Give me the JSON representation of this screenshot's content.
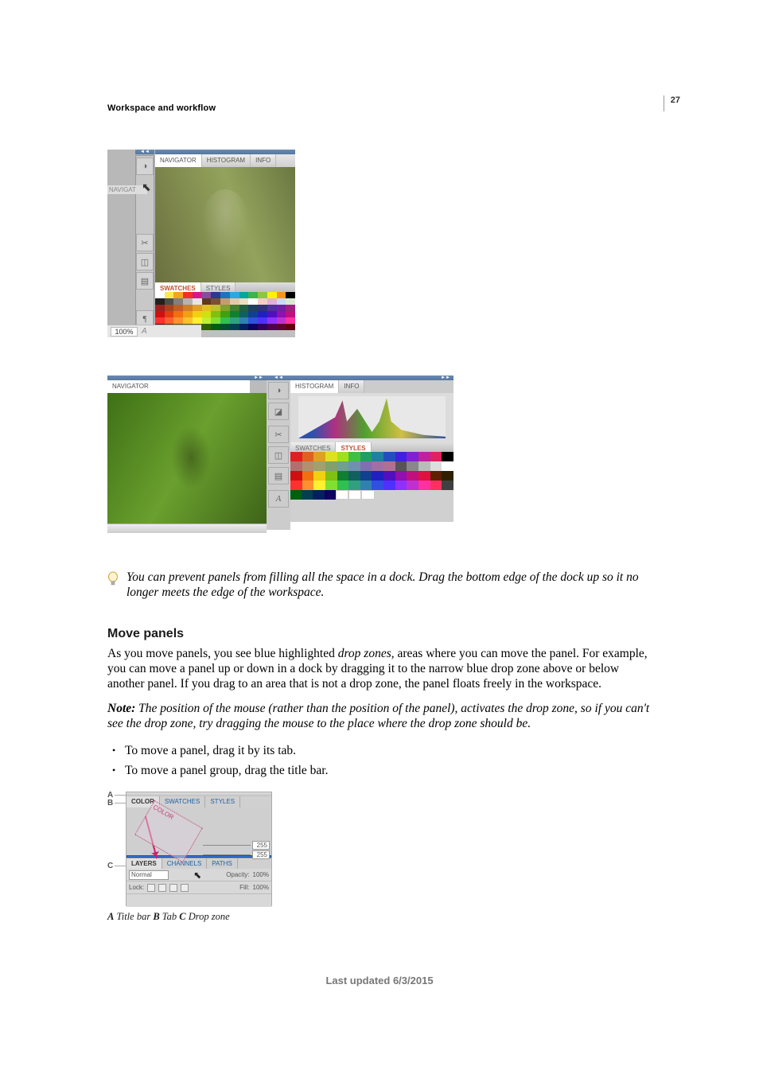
{
  "page_number": "27",
  "section_header": "Workspace and workflow",
  "figure1": {
    "left_label": "NAVIGAT",
    "zoom_value": "100%",
    "a_icon": "A",
    "tabs": {
      "t1": "NAVIGATOR",
      "t2": "HISTOGRAM",
      "t3": "INFO"
    },
    "swatch_tabs": {
      "t1": "SWATCHES",
      "t2": "STYLES"
    }
  },
  "figure2": {
    "nav_tab": "NAVIGATOR",
    "histo_tabs": {
      "t1": "HISTOGRAM",
      "t2": "INFO"
    },
    "swatch_tabs": {
      "t1": "SWATCHES",
      "t2": "STYLES"
    },
    "a_icon": "A"
  },
  "tip_text": "You can prevent panels from filling all the space in a dock. Drag the bottom edge of the dock up so it no longer meets the edge of the workspace.",
  "heading": "Move panels",
  "paragraph_pre": "As you move panels, you see blue highlighted ",
  "paragraph_em": "drop zones",
  "paragraph_post": ", areas where you can move the panel. For example, you can move a panel up or down in a dock by dragging it to the narrow blue drop zone above or below another panel. If you drag to an area that is not a drop zone, the panel floats freely in the workspace.",
  "note": {
    "label": "Note:",
    "text": " The position of the mouse (rather than the position of the panel), activates the drop zone, so if you can't see the drop zone, try dragging the mouse to the place where the drop zone should be."
  },
  "bullets": {
    "b1": "To move a panel, drag it by its tab.",
    "b2": "To move a panel group, drag the title bar."
  },
  "figure3": {
    "labels": {
      "A": "A",
      "B": "B",
      "C": "C"
    },
    "tabs1": {
      "t1": "COLOR",
      "t2": "SWATCHES",
      "t3": "STYLES"
    },
    "drag_label": "COLOR",
    "tabs2": {
      "t1": "LAYERS",
      "t2": "CHANNELS",
      "t3": "PATHS"
    },
    "row1": {
      "mode": "Normal",
      "opacity_lbl": "Opacity:",
      "opacity_val": "100%"
    },
    "row2": {
      "lock": "Lock:",
      "fill_lbl": "Fill:",
      "fill_val": "100%"
    },
    "slider": "255",
    "slider2": "255",
    "caption": {
      "A": "A",
      "A_text": " Title bar  ",
      "B": "B",
      "B_text": " Tab  ",
      "C": "C",
      "C_text": " Drop zone"
    }
  },
  "footer": "Last updated 6/3/2015"
}
